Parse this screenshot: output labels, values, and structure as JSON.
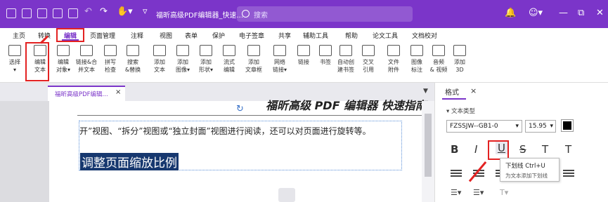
{
  "titlebar": {
    "title": "福昕高级PDF编辑器_快速...",
    "search_placeholder": "搜索",
    "min": "—",
    "restore": "⧉",
    "close": "✕"
  },
  "menu": [
    "主页",
    "转换",
    "编辑",
    "页面管理",
    "注释",
    "视图",
    "表单",
    "保护",
    "电子签章",
    "共享",
    "辅助工具",
    "帮助",
    "论文工具",
    "文档校对"
  ],
  "ribbon": [
    {
      "l1": "选择",
      "l2": "▾"
    },
    {
      "l1": "编辑",
      "l2": "文本"
    },
    {
      "l1": "编辑",
      "l2": "对象▾"
    },
    {
      "l1": "链接&合",
      "l2": "并文本"
    },
    {
      "l1": "拼写",
      "l2": "检查"
    },
    {
      "l1": "搜索",
      "l2": "&替换"
    },
    {
      "l1": "添加",
      "l2": "文本"
    },
    {
      "l1": "添加",
      "l2": "图像▾"
    },
    {
      "l1": "添加",
      "l2": "形状▾"
    },
    {
      "l1": "流式",
      "l2": "编辑"
    },
    {
      "l1": "添加",
      "l2": "文章框"
    },
    {
      "l1": "网络",
      "l2": "链接▾"
    },
    {
      "l1": "链接",
      "l2": ""
    },
    {
      "l1": "书签",
      "l2": ""
    },
    {
      "l1": "自动创",
      "l2": "建书签"
    },
    {
      "l1": "交叉",
      "l2": "引用"
    },
    {
      "l1": "文件",
      "l2": "附件"
    },
    {
      "l1": "图像",
      "l2": "标注"
    },
    {
      "l1": "音频",
      "l2": "& 视频"
    },
    {
      "l1": "添加",
      "l2": "3D"
    }
  ],
  "doc_tab": {
    "label": "福昕高级PDF编辑...",
    "close": "×"
  },
  "document": {
    "heading": "福昕高级 PDF 编辑器 快速指南",
    "body_text": "开”视图、“拆分”视图或“独立封面”视图进行阅读，还可以对页面进行旋转等。",
    "selected_heading": "调整页面缩放比例"
  },
  "panel": {
    "tab": "格式",
    "close": "×",
    "section": "▾ 文本类型",
    "font": "FZSSJW--GB1-0",
    "size": "15.95",
    "text_color": "#000000",
    "fmt": [
      "B",
      "I",
      "U",
      "S",
      "T",
      "T"
    ]
  },
  "tooltip": {
    "title": "下划线     Ctrl+U",
    "desc": "为文本添加下划线"
  },
  "colors": {
    "accent": "#7b35c9",
    "highlight": "#e32222"
  }
}
